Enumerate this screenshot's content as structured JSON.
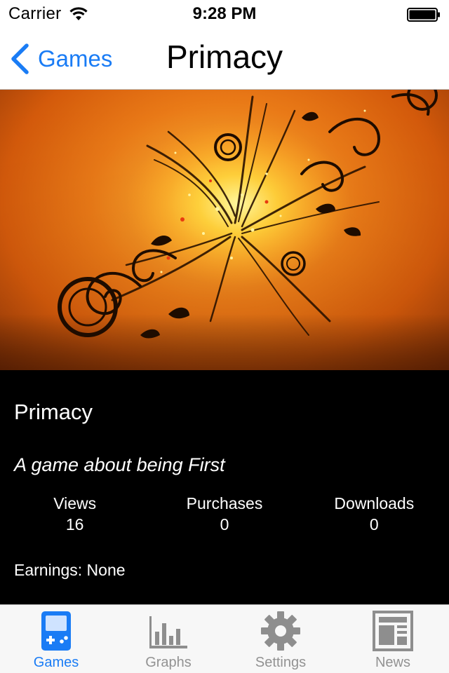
{
  "status_bar": {
    "carrier": "Carrier",
    "time": "9:28 PM",
    "icons": [
      "wifi-icon",
      "battery-icon"
    ]
  },
  "nav": {
    "back_label": "Games",
    "title": "Primacy",
    "accent_color": "#1a7cf5"
  },
  "hero": {
    "icon": "game-artwork-image"
  },
  "details": {
    "name": "Primacy",
    "tagline": "A game about being First",
    "stats": [
      {
        "label": "Views",
        "value": "16"
      },
      {
        "label": "Purchases",
        "value": "0"
      },
      {
        "label": "Downloads",
        "value": "0"
      }
    ],
    "earnings": "Earnings: None"
  },
  "tabs": [
    {
      "label": "Games",
      "icon": "gameboy-icon",
      "active": true
    },
    {
      "label": "Graphs",
      "icon": "bar-chart-icon",
      "active": false
    },
    {
      "label": "Settings",
      "icon": "gear-icon",
      "active": false
    },
    {
      "label": "News",
      "icon": "newspaper-icon",
      "active": false
    }
  ]
}
